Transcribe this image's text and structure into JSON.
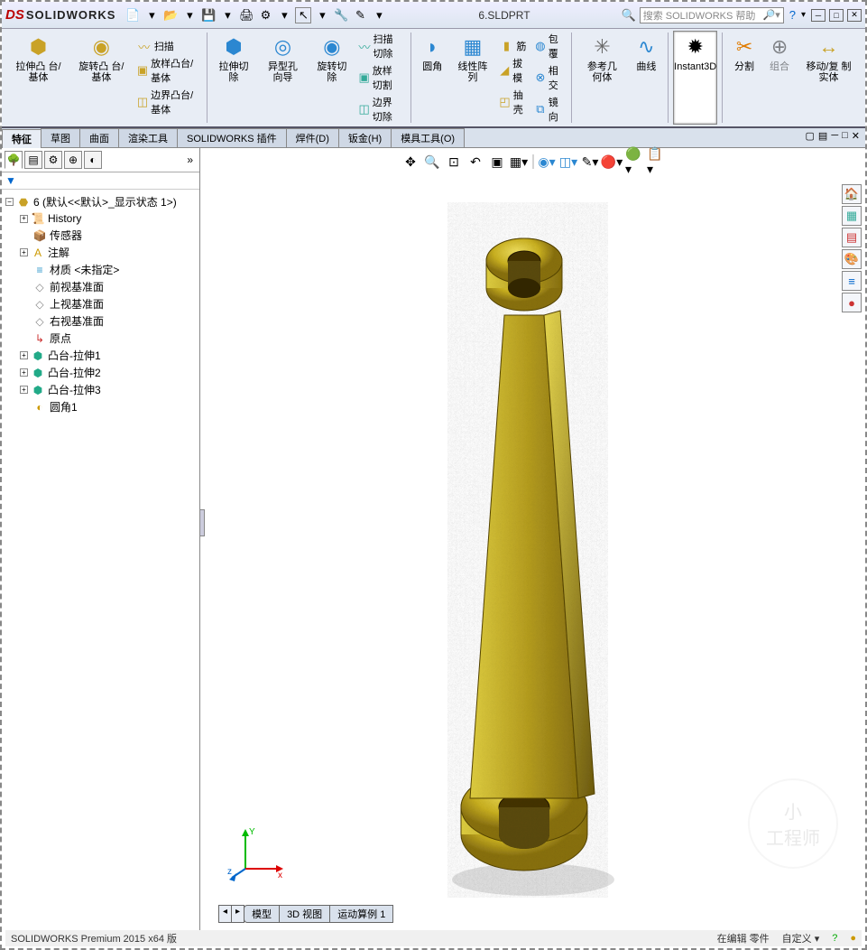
{
  "app": {
    "logo1": "DS",
    "logo2": "SOLIDWORKS"
  },
  "doctitle": "6.SLDPRT",
  "search_placeholder": "搜索 SOLIDWORKS 帮助",
  "qat_icons": [
    "new-doc-icon",
    "open-icon",
    "save-icon",
    "print-icon",
    "options-icon",
    "rebuild-icon",
    "select-icon",
    "sketch-icon"
  ],
  "ribbon": {
    "big": [
      {
        "id": "extrude-boss",
        "label": "拉伸凸\n台/基体",
        "color": "#c9a227"
      },
      {
        "id": "revolve-boss",
        "label": "旋转凸\n台/基体",
        "color": "#c9a227"
      }
    ],
    "small1": [
      {
        "id": "sweep",
        "label": "扫描"
      },
      {
        "id": "loft",
        "label": "放样凸台/基体"
      },
      {
        "id": "boundary",
        "label": "边界凸台/基体"
      }
    ],
    "big2": [
      {
        "id": "extrude-cut",
        "label": "拉伸切\n除",
        "color": "#2b87d1"
      },
      {
        "id": "hole-wizard",
        "label": "异型孔\n向导",
        "color": "#2b87d1"
      },
      {
        "id": "revolve-cut",
        "label": "旋转切\n除",
        "color": "#2b87d1"
      }
    ],
    "small2": [
      {
        "id": "sweep-cut",
        "label": "扫描切除"
      },
      {
        "id": "loft-cut",
        "label": "放样切割"
      },
      {
        "id": "boundary-cut",
        "label": "边界切除"
      }
    ],
    "big3": [
      {
        "id": "fillet",
        "label": "圆角",
        "color": "#2b87d1"
      },
      {
        "id": "linear-pattern",
        "label": "线性阵\n列",
        "color": "#2b87d1"
      }
    ],
    "small3": [
      {
        "id": "rib",
        "label": "筋"
      },
      {
        "id": "draft",
        "label": "拔模"
      },
      {
        "id": "shell",
        "label": "抽壳"
      }
    ],
    "small4": [
      {
        "id": "wrap",
        "label": "包覆"
      },
      {
        "id": "intersect",
        "label": "相交"
      },
      {
        "id": "mirror",
        "label": "镜向"
      }
    ],
    "big4": [
      {
        "id": "ref-geom",
        "label": "参考几\n何体",
        "color": "#6b6b6b"
      },
      {
        "id": "curves",
        "label": "曲线",
        "color": "#2b87d1"
      },
      {
        "id": "instant3d",
        "label": "Instant3D",
        "color": "#888"
      },
      {
        "id": "split",
        "label": "分割",
        "color": "#e07b00"
      },
      {
        "id": "combine",
        "label": "组合",
        "color": "#aaa"
      },
      {
        "id": "move-copy",
        "label": "移动/复\n制实体",
        "color": "#c9a227"
      }
    ]
  },
  "tabs": [
    "特征",
    "草图",
    "曲面",
    "渲染工具",
    "SOLIDWORKS 插件",
    "焊件(D)",
    "钣金(H)",
    "模具工具(O)"
  ],
  "active_tab": 0,
  "tree": {
    "root": "6  (默认<<默认>_显示状态 1>)",
    "items": [
      {
        "exp": "+",
        "icon": "📜",
        "label": "History",
        "color": "#8a6"
      },
      {
        "exp": "",
        "icon": "📦",
        "label": "传感器",
        "color": "#c90"
      },
      {
        "exp": "+",
        "icon": "A",
        "label": "注解",
        "color": "#c90"
      },
      {
        "exp": "",
        "icon": "≡",
        "label": "材质 <未指定>",
        "color": "#39c"
      },
      {
        "exp": "",
        "icon": "◇",
        "label": "前视基准面",
        "color": "#888"
      },
      {
        "exp": "",
        "icon": "◇",
        "label": "上视基准面",
        "color": "#888"
      },
      {
        "exp": "",
        "icon": "◇",
        "label": "右视基准面",
        "color": "#888"
      },
      {
        "exp": "",
        "icon": "↳",
        "label": "原点",
        "color": "#c33"
      },
      {
        "exp": "+",
        "icon": "⬢",
        "label": "凸台-拉伸1",
        "color": "#2a8"
      },
      {
        "exp": "+",
        "icon": "⬢",
        "label": "凸台-拉伸2",
        "color": "#2a8"
      },
      {
        "exp": "+",
        "icon": "⬢",
        "label": "凸台-拉伸3",
        "color": "#2a8"
      },
      {
        "exp": "",
        "icon": "◐",
        "label": "圆角1",
        "color": "#c90"
      }
    ]
  },
  "viewtoolbar": [
    "orient-icon",
    "zoom-fit-icon",
    "zoom-area-icon",
    "prev-view-icon",
    "section-icon",
    "display-style-icon",
    "hide-show-icon",
    "cube-icon",
    "box-icon",
    "edit-appearance-icon",
    "appearance-icon",
    "scene-icon",
    "settings-icon"
  ],
  "rightbar": [
    "home-icon",
    "cube-view-icon",
    "motion-icon",
    "paint-icon",
    "list-icon",
    "sphere-icon"
  ],
  "bottom_tabs": [
    "模型",
    "3D 视图",
    "运动算例 1"
  ],
  "status": {
    "left": "SOLIDWORKS Premium 2015 x64 版",
    "edit": "在编辑 零件",
    "custom": "自定义"
  },
  "triad": {
    "x": "x",
    "y": "Y",
    "z": "z"
  },
  "watermark": "工程师"
}
